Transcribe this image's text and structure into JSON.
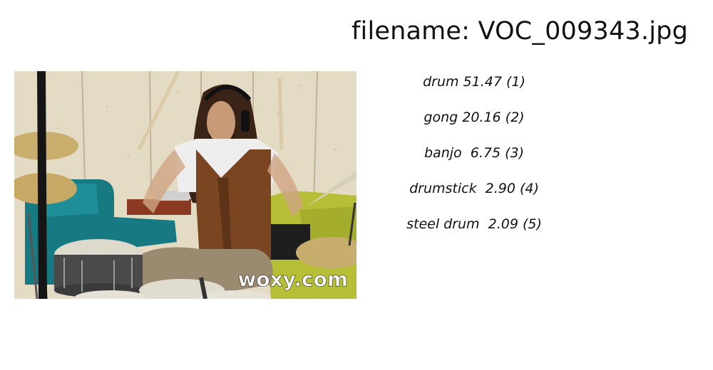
{
  "header": {
    "filename_label": "filename: VOC_009343.jpg"
  },
  "image": {
    "watermark": "woxy.com",
    "colors": {
      "wall": "#e6ddc7",
      "sofa_left": "#1a7d86",
      "sofa_right": "#b9c23a",
      "vest": "#7a4622",
      "hair": "#3a2418",
      "pants": "#9a8a70",
      "cymbal": "#c9ae6e"
    }
  },
  "predictions": [
    {
      "text": "drum 51.47 (1)"
    },
    {
      "text": "gong 20.16 (2)"
    },
    {
      "text": "banjo  6.75 (3)"
    },
    {
      "text": "drumstick  2.90 (4)"
    },
    {
      "text": "steel drum  2.09 (5)"
    }
  ]
}
